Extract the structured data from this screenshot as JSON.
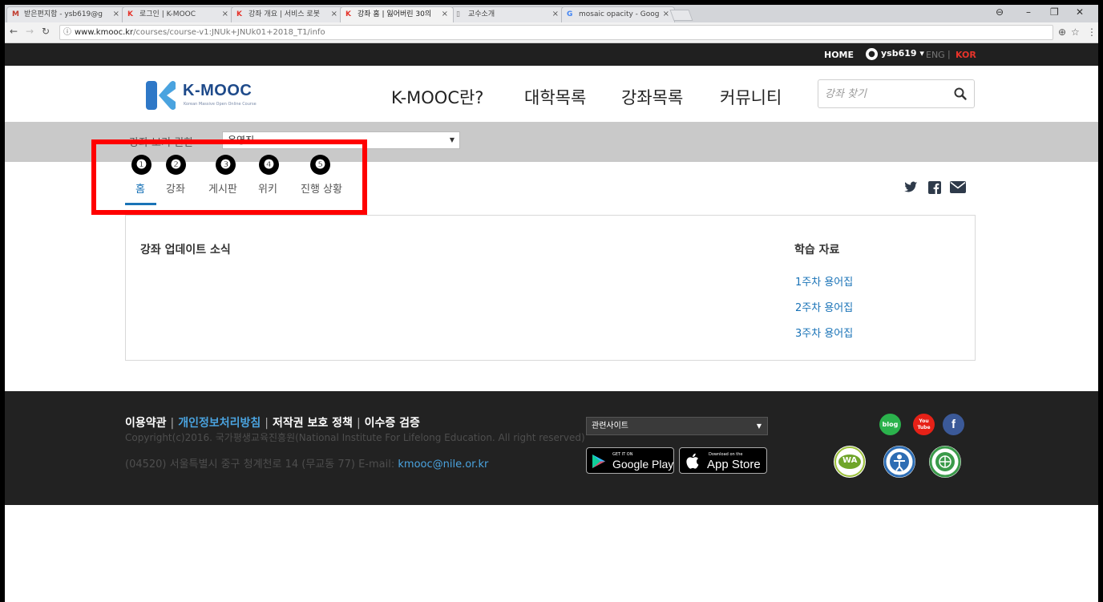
{
  "browser": {
    "tabs": [
      {
        "icon": "gmail-icon",
        "label": "받은편지함 - ysb619@g"
      },
      {
        "icon": "kmooc-icon",
        "label": "로그인 | K-MOOC"
      },
      {
        "icon": "kmooc-icon",
        "label": "강좌 개요 | 서비스 로봇"
      },
      {
        "icon": "kmooc-icon",
        "label": "강좌 홈 | 잃어버린 30의"
      },
      {
        "icon": "page-icon",
        "label": "교수소개"
      },
      {
        "icon": "google-icon",
        "label": "mosaic opacity - Googl"
      }
    ],
    "url_host": "www.kmooc.kr",
    "url_path": "/courses/course-v1:JNUk+JNUk01+2018_T1/info"
  },
  "topbar": {
    "home": "HOME",
    "user": "ysb619",
    "eng": "ENG",
    "kor": "KOR"
  },
  "header": {
    "logo_text": "K-MOOC",
    "logo_sub": "Korean Massive Open Online Course",
    "nav": [
      "K-MOOC란?",
      "대학목록",
      "강좌목록",
      "커뮤니티"
    ],
    "search_placeholder": "강좌 찾기"
  },
  "subbar": {
    "label": "강좌 보기 권한",
    "select_value": "운영진"
  },
  "course_tabs": {
    "numbers": [
      "❶",
      "❷",
      "❸",
      "❹",
      "❺"
    ],
    "items": [
      "홈",
      "강좌",
      "게시판",
      "위키",
      "진행 상황"
    ]
  },
  "content": {
    "updates_title": "강좌 업데이트 소식",
    "materials_title": "학습 자료",
    "materials": [
      "1주차 용어집",
      "2주차 용어집",
      "3주차 용어집"
    ]
  },
  "footer": {
    "links": [
      "이용약관",
      "개인정보처리방침",
      "저작권 보호 정책",
      "이수증 검증"
    ],
    "copyright": "Copyright(c)2016. 국가평생교육진흥원(National Institute For Lifelong Education. All right reserved)",
    "address": "(04520) 서울특별시 중구 청계천로 14 (무교동 77) E-mail: ",
    "email": "kmooc@nile.or.kr",
    "related_select": "관련사이트",
    "google_play_small": "GET IT ON",
    "google_play": "Google Play",
    "app_store_small": "Download on the",
    "app_store": "App Store",
    "sns": [
      "blog",
      "You Tube",
      "f"
    ],
    "cert_wa": "WA"
  },
  "colors": {
    "accent_blue": "#1a73b7",
    "kmooc_red": "#e8332a",
    "highlight_red": "#ff0000"
  }
}
